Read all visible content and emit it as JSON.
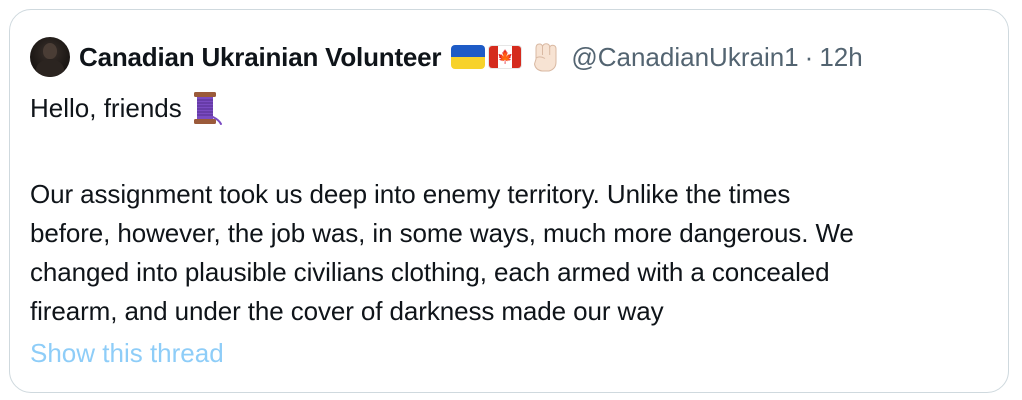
{
  "tweet": {
    "author": {
      "display_name": "Canadian Ukrainian Volunteer",
      "handle": "@CanadianUkrain1",
      "separator": "·",
      "time": "12h",
      "avatar_icon": "profile-avatar",
      "badges": [
        "ukraine-flag-icon",
        "canada-flag-icon",
        "raised-fist-icon"
      ],
      "maple_leaf": "🍁"
    },
    "greeting": "Hello, friends",
    "greeting_icon": "thread-spool-icon",
    "body_lines": [
      "Our assignment took us deep into enemy territory. Unlike the times",
      "before, however, the job was, in some ways, much more dangerous. We",
      "changed into plausible civilians clothing, each armed with a concealed",
      "firearm, and under the cover of darkness made our way"
    ],
    "show_thread_label": "Show this thread"
  },
  "colors": {
    "border": "#cfd9de",
    "text": "#0f1419",
    "muted": "#536471",
    "link": "#8ecdf8",
    "ukraine_blue": "#1e5bc6",
    "ukraine_yellow": "#f7d22b",
    "canada_red": "#d52b1e"
  }
}
